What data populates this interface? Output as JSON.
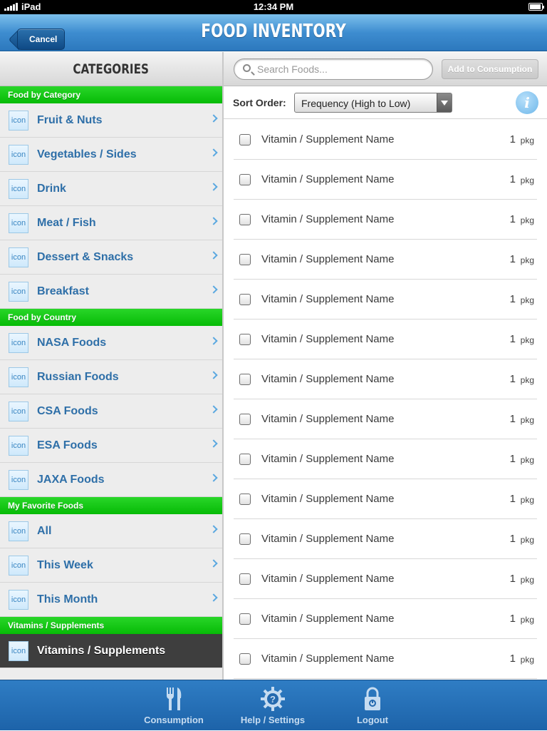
{
  "status_bar": {
    "carrier": "iPad",
    "time": "12:34 PM"
  },
  "nav": {
    "title": "FOOD INVENTORY",
    "cancel_label": "Cancel"
  },
  "sidebar": {
    "title": "CATEGORIES",
    "icon_text": "icon",
    "sections": [
      {
        "title": "Food by Category",
        "items": [
          "Fruit & Nuts",
          "Vegetables / Sides",
          "Drink",
          "Meat / Fish",
          "Dessert & Snacks",
          "Breakfast"
        ]
      },
      {
        "title": "Food by Country",
        "items": [
          "NASA Foods",
          "Russian Foods",
          "CSA Foods",
          "ESA Foods",
          "JAXA Foods"
        ]
      },
      {
        "title": "My Favorite Foods",
        "items": [
          "All",
          "This Week",
          "This Month"
        ]
      },
      {
        "title": "Vitamins / Supplements",
        "items": [
          "Vitamins / Supplements"
        ]
      }
    ],
    "selected_item": "Vitamins / Supplements"
  },
  "toolbar": {
    "search_placeholder": "Search Foods...",
    "add_button": "Add to Consumption"
  },
  "sort": {
    "label": "Sort Order:",
    "value": "Frequency (High to Low)",
    "info_glyph": "i"
  },
  "food_items": [
    {
      "name": "Vitamin / Supplement Name",
      "qty": "1",
      "unit": "pkg"
    },
    {
      "name": "Vitamin / Supplement Name",
      "qty": "1",
      "unit": "pkg"
    },
    {
      "name": "Vitamin / Supplement Name",
      "qty": "1",
      "unit": "pkg"
    },
    {
      "name": "Vitamin / Supplement Name",
      "qty": "1",
      "unit": "pkg"
    },
    {
      "name": "Vitamin / Supplement Name",
      "qty": "1",
      "unit": "pkg"
    },
    {
      "name": "Vitamin / Supplement Name",
      "qty": "1",
      "unit": "pkg"
    },
    {
      "name": "Vitamin / Supplement Name",
      "qty": "1",
      "unit": "pkg"
    },
    {
      "name": "Vitamin / Supplement Name",
      "qty": "1",
      "unit": "pkg"
    },
    {
      "name": "Vitamin / Supplement Name",
      "qty": "1",
      "unit": "pkg"
    },
    {
      "name": "Vitamin / Supplement Name",
      "qty": "1",
      "unit": "pkg"
    },
    {
      "name": "Vitamin / Supplement Name",
      "qty": "1",
      "unit": "pkg"
    },
    {
      "name": "Vitamin / Supplement Name",
      "qty": "1",
      "unit": "pkg"
    },
    {
      "name": "Vitamin / Supplement Name",
      "qty": "1",
      "unit": "pkg"
    },
    {
      "name": "Vitamin / Supplement Name",
      "qty": "1",
      "unit": "pkg"
    }
  ],
  "tabs": [
    {
      "label": "Consumption",
      "icon": "fork-knife-icon"
    },
    {
      "label": "Help / Settings",
      "icon": "gear-help-icon"
    },
    {
      "label": "Logout",
      "icon": "lock-icon"
    }
  ],
  "colors": {
    "nav_blue": "#3e8dd0",
    "section_green": "#06bb06",
    "category_text": "#2e6fa8",
    "selected_bg": "#3e3e3e",
    "tabbar_blue": "#1d63a9"
  }
}
